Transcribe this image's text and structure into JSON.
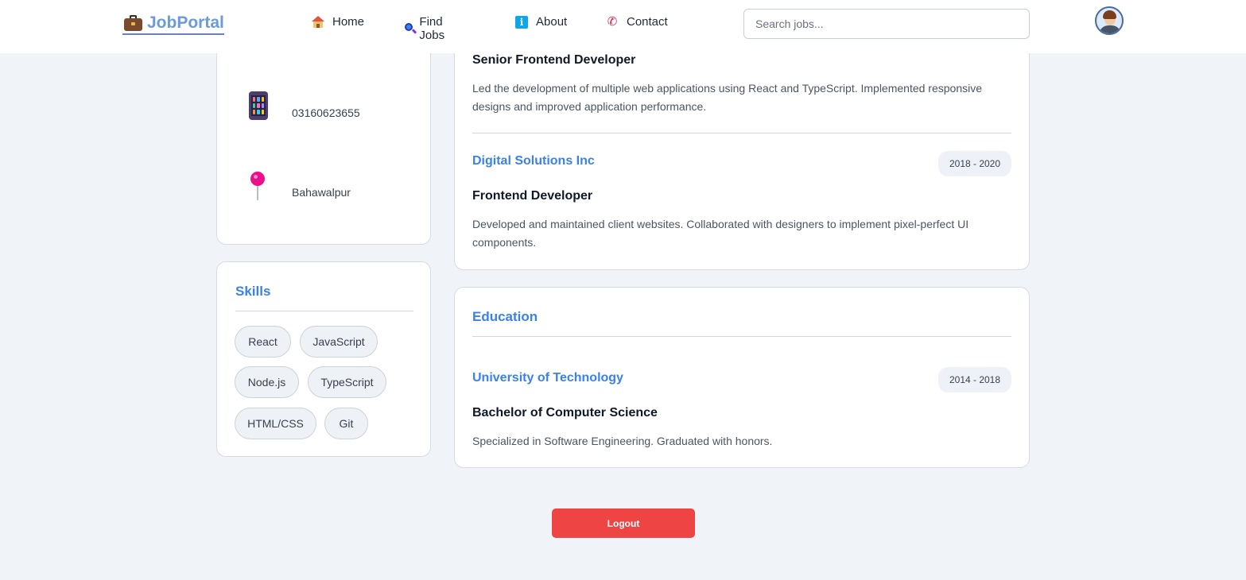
{
  "brand": {
    "name": "JobPortal",
    "icon": "briefcase-icon"
  },
  "nav": [
    {
      "label": "Home",
      "icon": "house-icon"
    },
    {
      "label": "Find Jobs",
      "icon": "search-icon"
    },
    {
      "label": "About",
      "icon": "info-icon"
    },
    {
      "label": "Contact",
      "icon": "phone-icon"
    }
  ],
  "search": {
    "placeholder": "Search jobs..."
  },
  "contact": {
    "phone": {
      "value": "03160623655",
      "icon": "mobile-phone-icon"
    },
    "location": {
      "value": "Bahawalpur",
      "icon": "pushpin-icon"
    }
  },
  "skills": {
    "title": "Skills",
    "items": [
      "React",
      "JavaScript",
      "Node.js",
      "TypeScript",
      "HTML/CSS",
      "Git"
    ]
  },
  "experience": {
    "items": [
      {
        "title": "Senior Frontend Developer",
        "description": "Led the development of multiple web applications using React and TypeScript. Implemented responsive designs and improved application performance."
      },
      {
        "company": "Digital Solutions Inc",
        "dates": "2018 - 2020",
        "title": "Frontend Developer",
        "description": "Developed and maintained client websites. Collaborated with designers to implement pixel-perfect UI components."
      }
    ]
  },
  "education": {
    "title": "Education",
    "items": [
      {
        "institution": "University of Technology",
        "dates": "2014 - 2018",
        "degree": "Bachelor of Computer Science",
        "description": "Specialized in Software Engineering. Graduated with honors."
      }
    ]
  },
  "logout_label": "Logout",
  "colors": {
    "accent": "#3b82e6",
    "danger": "#ef4444",
    "background": "#f0f3f7"
  }
}
